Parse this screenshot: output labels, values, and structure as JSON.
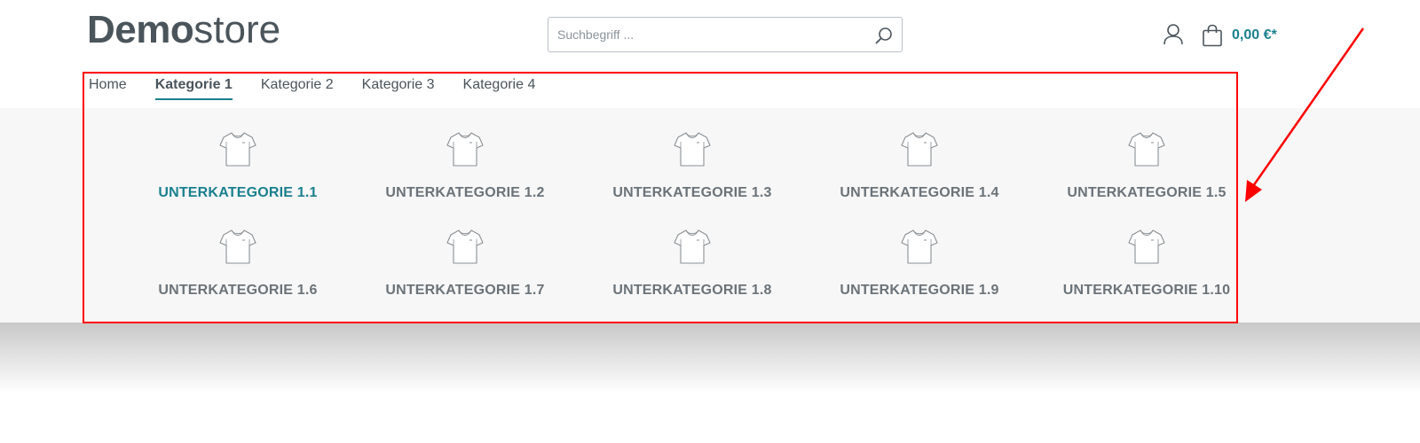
{
  "header": {
    "logo_bold": "Demo",
    "logo_light": "store",
    "search_placeholder": "Suchbegriff ...",
    "cart_amount": "0,00 €*"
  },
  "nav": {
    "items": [
      "Home",
      "Kategorie 1",
      "Kategorie 2",
      "Kategorie 3",
      "Kategorie 4"
    ],
    "active": "Kategorie 1"
  },
  "flyout": {
    "subcategories": [
      "UNTERKATEGORIE 1.1",
      "UNTERKATEGORIE 1.2",
      "UNTERKATEGORIE 1.3",
      "UNTERKATEGORIE 1.4",
      "UNTERKATEGORIE 1.5",
      "UNTERKATEGORIE 1.6",
      "UNTERKATEGORIE 1.7",
      "UNTERKATEGORIE 1.8",
      "UNTERKATEGORIE 1.9",
      "UNTERKATEGORIE 1.10"
    ],
    "active_subcategory": "UNTERKATEGORIE 1.1",
    "icon": "tshirt-icon"
  },
  "colors": {
    "accent": "#1a7f8e",
    "text": "#4a545b",
    "subcategory_text": "#6b7379",
    "flyout_background": "#f7f7f7",
    "annotation": "#ff0000"
  }
}
